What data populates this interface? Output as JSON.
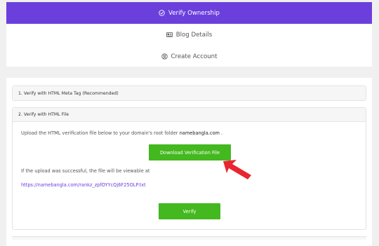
{
  "steps": {
    "items": [
      {
        "label": "Verify Ownership",
        "icon": "check-circle-icon",
        "active": true
      },
      {
        "label": "Blog Details",
        "icon": "id-card-icon",
        "active": false
      },
      {
        "label": "Create Account",
        "icon": "user-circle-icon",
        "active": false
      }
    ]
  },
  "methods": {
    "meta_tag": {
      "title": "1. Verify with HTML Meta Tag (Recommended)"
    },
    "html_file": {
      "title": "2. Verify with HTML File",
      "instruction_prefix": "Upload the HTML verification file below to your domain's root folder",
      "domain": "namebangla.com",
      "instruction_suffix": " .",
      "download_label": "Download Verification File",
      "success_text": "If the upload was successful, the file will be viewable at",
      "file_url": "https://namebangla.com/rankz_zpfOYYcQj6F25OLP.txt",
      "verify_label": "Verify"
    }
  },
  "colors": {
    "accent": "#6b3fdc",
    "button": "#43b81f",
    "arrow": "#e8262f"
  }
}
